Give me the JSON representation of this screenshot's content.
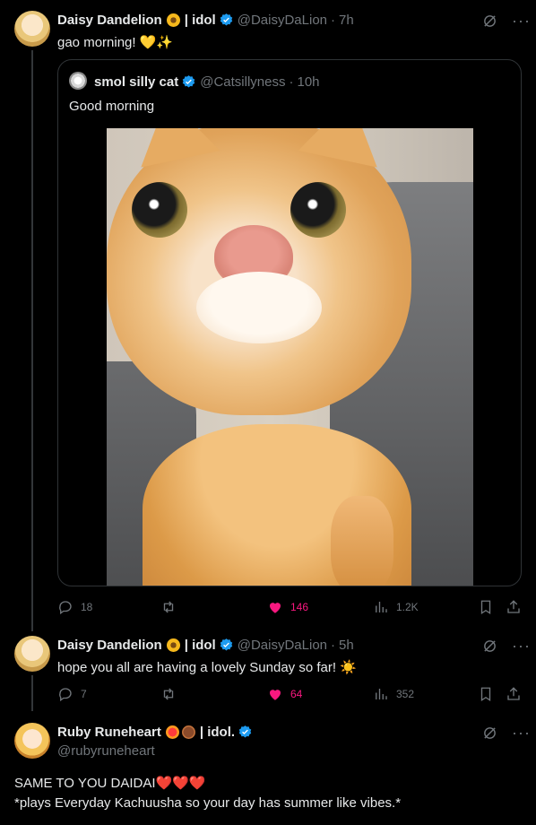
{
  "thread_main": {
    "author_name": "Daisy Dandelion",
    "badge_separator": "| idol",
    "handle": "@DaisyDaLion",
    "time": "7h",
    "text": "gao morning! 💛✨",
    "quote": {
      "author_name": "smol silly cat",
      "handle": "@Catsillyness",
      "time": "10h",
      "text": "Good morning",
      "image_icon": "cat-photo"
    },
    "stats": {
      "replies": "18",
      "reposts": "",
      "likes": "146",
      "views": "1.2K"
    }
  },
  "thread_reply": {
    "author_name": "Daisy Dandelion",
    "badge_separator": "| idol",
    "handle": "@DaisyDaLion",
    "time": "5h",
    "text": "hope you all are having a lovely Sunday so far! ☀️",
    "stats": {
      "replies": "7",
      "reposts": "",
      "likes": "64",
      "views": "352"
    }
  },
  "focused_reply": {
    "author_name": "Ruby Runeheart",
    "badge_separator": "| idol.",
    "handle": "@rubyruneheart",
    "text_line1": "SAME TO YOU DAIDAI",
    "text_line1_hearts": "❤️❤️❤️",
    "text_line2": "*plays Everyday Kachuusha so your day has summer like vibes.*"
  },
  "colors": {
    "background": "#000000",
    "text": "#e7e9ea",
    "muted": "#71767b",
    "verified": "#1d9bf0",
    "like": "#f91880",
    "border": "#2f3336"
  },
  "icons": [
    "grok-icon",
    "more-icon",
    "reply-icon",
    "repost-icon",
    "like-icon",
    "views-icon",
    "bookmark-icon",
    "share-icon",
    "verified-icon"
  ]
}
